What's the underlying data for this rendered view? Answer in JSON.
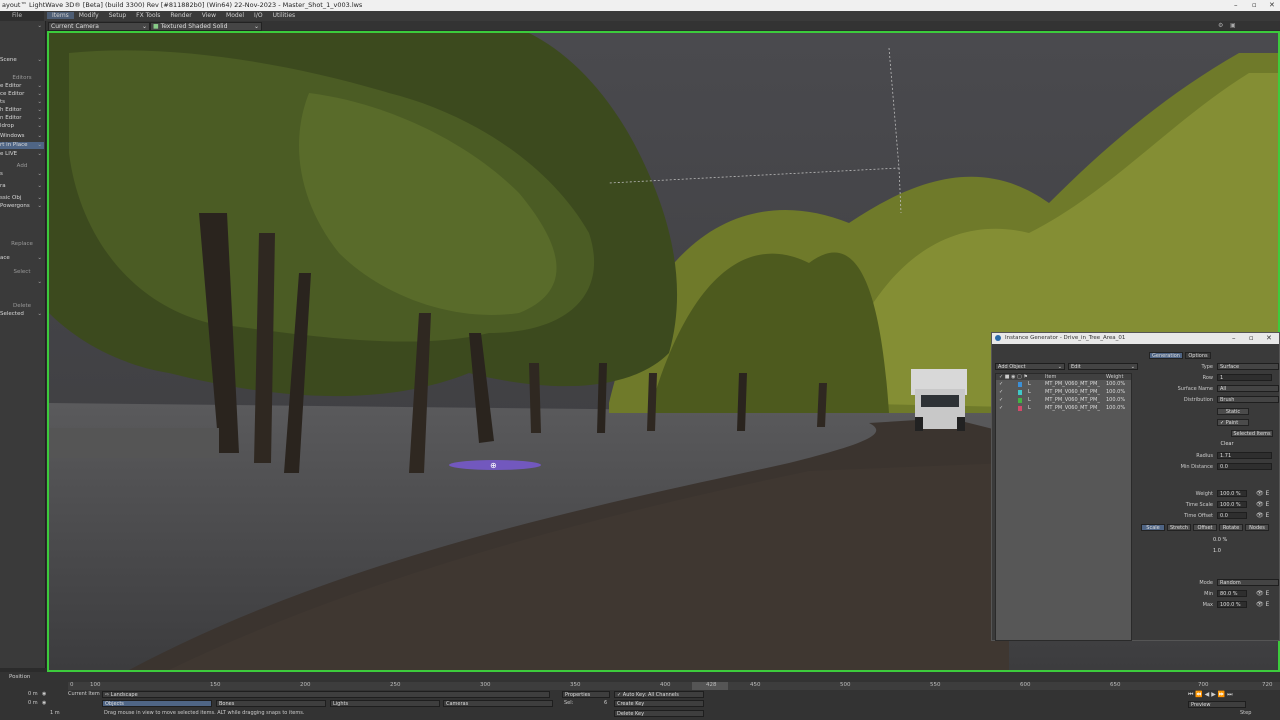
{
  "window": {
    "title": "ayout™ LightWave 3D® [Beta] (build 3300) Rev [#811882b0] (Win64) 22-Nov-2023 - Master_Shot_1_v003.lws"
  },
  "menubar": {
    "left_label": "File",
    "items": [
      "Items",
      "Modify",
      "Setup",
      "FX Tools",
      "Render",
      "View",
      "Model",
      "I/O",
      "Utilities"
    ],
    "active": "Items"
  },
  "viewport_bar": {
    "camera": "Current Camera",
    "shading": "Textured Shaded Solid"
  },
  "sidebar": {
    "items": [
      {
        "label": "",
        "kind": "dd"
      },
      {
        "label": "Scene",
        "kind": "dd"
      },
      {
        "label": "Editors",
        "kind": "head"
      },
      {
        "label": "e Editor",
        "kind": "item"
      },
      {
        "label": "ce Editor",
        "kind": "item"
      },
      {
        "label": "ts",
        "kind": "item"
      },
      {
        "label": "h Editor",
        "kind": "item"
      },
      {
        "label": "n Editor",
        "kind": "item"
      },
      {
        "label": "ldrop",
        "kind": "item"
      },
      {
        "label": "Windows",
        "kind": "item"
      },
      {
        "label": "rt in Place",
        "kind": "sel"
      },
      {
        "label": "e LIVE",
        "kind": "item"
      },
      {
        "label": "Add",
        "kind": "head"
      },
      {
        "label": "s",
        "kind": "item"
      },
      {
        "label": "ra",
        "kind": "item"
      },
      {
        "label": "ssic Obj",
        "kind": "item"
      },
      {
        "label": "Powergons",
        "kind": "item"
      },
      {
        "label": "Replace",
        "kind": "head"
      },
      {
        "label": "ace",
        "kind": "item"
      },
      {
        "label": "Select",
        "kind": "head"
      },
      {
        "label": "",
        "kind": "item"
      },
      {
        "label": "Delete",
        "kind": "head"
      },
      {
        "label": "Selected",
        "kind": "item"
      }
    ]
  },
  "instance_generator": {
    "title": "Instance Generator - Drive_in_Tree_Area_01",
    "add_object": "Add Object",
    "edit": "Edit",
    "list_header": {
      "item": "Item",
      "weight": "Weight"
    },
    "rows": [
      {
        "name": "MT_PM_V060_MT_PM_",
        "weight": "100.0%",
        "color": "#3b8fd6"
      },
      {
        "name": "MT_PM_V060_MT_PM_",
        "weight": "100.0%",
        "color": "#40c8c8"
      },
      {
        "name": "MT_PM_V060_MT_PM_",
        "weight": "100.0%",
        "color": "#44b244"
      },
      {
        "name": "MT_PM_V060_MT_PM_",
        "weight": "100.0%",
        "color": "#d24a6a"
      }
    ],
    "tabs": [
      "Generation",
      "Options"
    ],
    "active_tab": "Generation",
    "fields": {
      "type_label": "Type",
      "type_value": "Surface",
      "row_label": "Row",
      "row_value": "1",
      "surface_label": "Surface Name",
      "surface_value": "All",
      "distribution_label": "Distribution",
      "distribution_value": "Brush",
      "static_btn": "Static",
      "paint_label": "Paint",
      "selected_items": "Selected Items",
      "clear_btn": "Clear",
      "radius_label": "Radius",
      "radius_value": "1.71",
      "mindist_label": "Min Distance",
      "mindist_value": "0.0",
      "weight_label": "Weight",
      "weight_value": "100.0 %",
      "timescale_label": "Time Scale",
      "timescale_value": "100.0 %",
      "timeoffset_label": "Time Offset",
      "timeoffset_value": "0.0",
      "subtabs": [
        "Scale",
        "Stretch",
        "Offset",
        "Rotate",
        "Nodes"
      ],
      "sub_val1": "0.0 %",
      "sub_val2": "1.0",
      "mode_label": "Mode",
      "mode_value": "Random",
      "min_label": "Min",
      "min_value": "80.0 %",
      "max_label": "Max",
      "max_value": "100.0 %"
    }
  },
  "timeline": {
    "position_label": "Position",
    "ticks": [
      "0",
      "100",
      "150",
      "200",
      "250",
      "300",
      "350",
      "400",
      "428",
      "450",
      "500",
      "550",
      "600",
      "650",
      "700",
      "720"
    ],
    "current_frame": "428",
    "rows": [
      {
        "time": "0 m",
        "label": "Current Item",
        "value": "Landscape"
      },
      {
        "time": "0 m",
        "label": "",
        "value": "Objects"
      },
      {
        "time": "1 m",
        "label": "",
        "value": "Drag mouse in view to move selected items. ALT while dragging snaps to items."
      }
    ],
    "bones": "Bones",
    "lights": "Lights",
    "cameras": "Cameras",
    "properties": "Properties",
    "sel_label": "Sel:",
    "sel_value": "6",
    "auto_key": "Auto Key: All Channels",
    "create_key": "Create Key",
    "delete_key": "Delete Key",
    "preview": "Preview",
    "step": "Step"
  }
}
